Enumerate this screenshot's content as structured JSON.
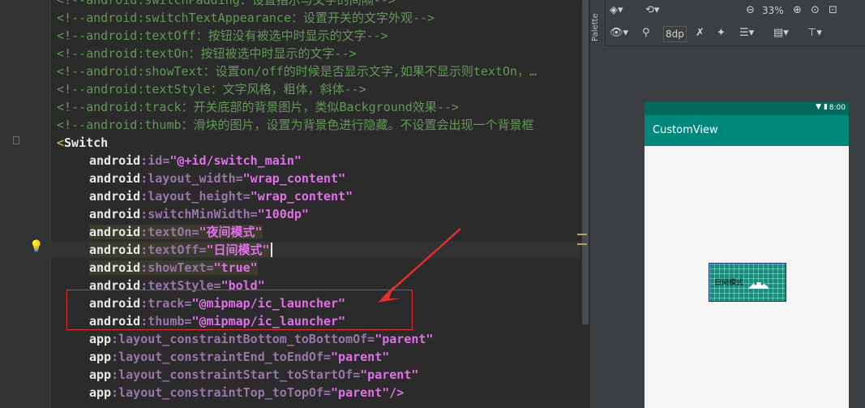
{
  "editor": {
    "lines": [
      {
        "kind": "comment",
        "text": "<!--android:switchPadding：设置指示与文字的间隔-->"
      },
      {
        "kind": "comment",
        "text": "<!--android:switchTextAppearance：设置开关的文字外观-->"
      },
      {
        "kind": "comment",
        "text": "<!--android:textOff：按钮没有被选中时显示的文字-->"
      },
      {
        "kind": "comment",
        "text": "<!--android:textOn：按钮被选中时显示的文字-->"
      },
      {
        "kind": "comment",
        "text": "<!--android:showText：设置on/off的时候是否显示文字,如果不显示则textOn，…"
      },
      {
        "kind": "comment",
        "text": "<!--android:textStyle：文字风格，粗体，斜体-->"
      },
      {
        "kind": "comment",
        "text": "<!--android:track：开关底部的背景图片，类似Background效果-->"
      },
      {
        "kind": "comment",
        "text": "<!--android:thumb：滑块的图片，设置为背景色进行隐藏。不设置会出现一个背景框"
      },
      {
        "kind": "tag",
        "bracket": "<",
        "name": "Switch"
      },
      {
        "kind": "attr",
        "ns": "android",
        "name": ":id=",
        "value": "\"@+id/switch_main\""
      },
      {
        "kind": "attr",
        "ns": "android",
        "name": ":layout_width=",
        "value": "\"wrap_content\""
      },
      {
        "kind": "attr",
        "ns": "android",
        "name": ":layout_height=",
        "value": "\"wrap_content\""
      },
      {
        "kind": "attr",
        "ns": "android",
        "name": ":switchMinWidth=",
        "value": "\"100dp\""
      },
      {
        "kind": "attr",
        "ns": "android",
        "name": ":textOn=",
        "value": "\"夜间模式\"",
        "hl": true
      },
      {
        "kind": "attr",
        "ns": "android",
        "name": ":textOff=",
        "value": "\"日间模式\"",
        "hl": true,
        "cur": true
      },
      {
        "kind": "attr",
        "ns": "android",
        "name": ":showText=",
        "value": "\"true\"",
        "hl": true
      },
      {
        "kind": "attr",
        "ns": "android",
        "name": ":textStyle=",
        "value": "\"bold\""
      },
      {
        "kind": "attr",
        "ns": "android",
        "name": ":track=",
        "value": "\"@mipmap/ic_launcher\""
      },
      {
        "kind": "attr",
        "ns": "android",
        "name": ":thumb=",
        "value": "\"@mipmap/ic_launcher\""
      },
      {
        "kind": "attr",
        "ns": "app",
        "name": ":layout_constraintBottom_toBottomOf=",
        "value": "\"parent\""
      },
      {
        "kind": "attr",
        "ns": "app",
        "name": ":layout_constraintEnd_toEndOf=",
        "value": "\"parent\""
      },
      {
        "kind": "attr",
        "ns": "app",
        "name": ":layout_constraintStart_toStartOf=",
        "value": "\"parent\""
      },
      {
        "kind": "attr",
        "ns": "app",
        "name": ":layout_constraintTop_toTopOf=",
        "value": "\"parent\"/>"
      }
    ]
  },
  "palette": {
    "label": "Palette"
  },
  "toolbar": {
    "zoom": "33%",
    "margin": "8dp"
  },
  "device": {
    "clock": "8:00",
    "app_title": "CustomView",
    "switch_text": "日间模式"
  },
  "colors": {
    "status_bar": "#00695c",
    "app_bar": "#00897b",
    "annotation": "#e03030"
  }
}
